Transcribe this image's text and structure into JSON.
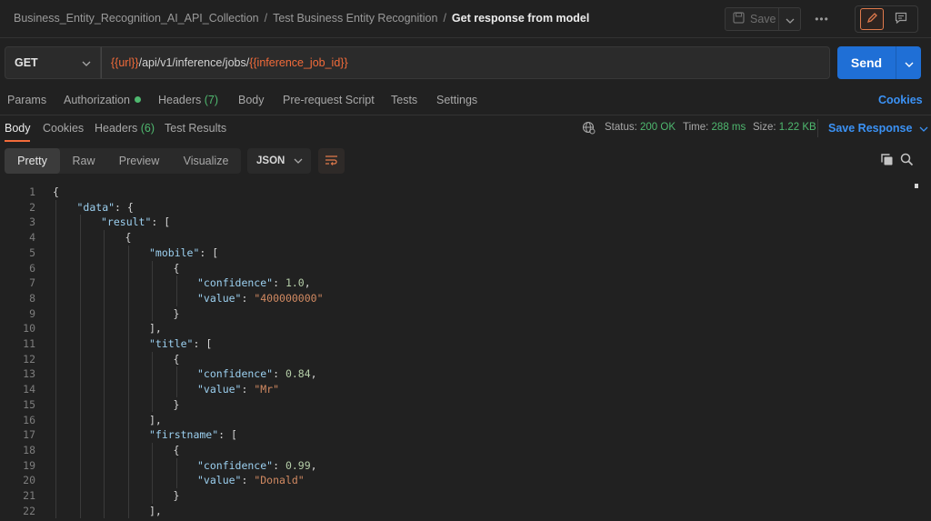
{
  "breadcrumb": {
    "items": [
      "Business_Entity_Recognition_AI_API_Collection",
      "Test Business Entity Recognition"
    ],
    "current": "Get response from model",
    "separator": "/"
  },
  "toolbar": {
    "save_label": "Save",
    "more_label": "•••"
  },
  "request": {
    "method": "GET",
    "url_var1": "{{url}}",
    "url_path": "/api/v1/inference/jobs/",
    "url_var2": "{{inference_job_id}}",
    "send_label": "Send"
  },
  "request_tabs": {
    "params": "Params",
    "authorization": "Authorization",
    "headers": "Headers",
    "headers_count": "(7)",
    "body": "Body",
    "prerequest": "Pre-request Script",
    "tests": "Tests",
    "settings": "Settings",
    "cookies": "Cookies"
  },
  "response_tabs": {
    "body": "Body",
    "cookies": "Cookies",
    "headers": "Headers",
    "headers_count": "(6)",
    "test_results": "Test Results"
  },
  "status": {
    "status_label": "Status:",
    "status_value": "200 OK",
    "time_label": "Time:",
    "time_value": "288 ms",
    "size_label": "Size:",
    "size_value": "1.22 KB",
    "save_response": "Save Response"
  },
  "view_modes": [
    "Pretty",
    "Raw",
    "Preview",
    "Visualize"
  ],
  "active_view": "Pretty",
  "format": "JSON",
  "colors": {
    "accent_orange": "#f26b3a",
    "send_blue": "#1f6fd6",
    "status_green": "#4fb86f",
    "link_blue": "#3b92f5"
  },
  "code_lines": [
    {
      "num": "1",
      "indent": 0,
      "tokens": [
        [
          "p",
          "{"
        ]
      ]
    },
    {
      "num": "2",
      "indent": 1,
      "tokens": [
        [
          "k",
          "\"data\""
        ],
        [
          "p",
          ": {"
        ]
      ]
    },
    {
      "num": "3",
      "indent": 2,
      "tokens": [
        [
          "k",
          "\"result\""
        ],
        [
          "p",
          ": ["
        ]
      ]
    },
    {
      "num": "4",
      "indent": 3,
      "tokens": [
        [
          "p",
          "{"
        ]
      ]
    },
    {
      "num": "5",
      "indent": 4,
      "tokens": [
        [
          "k",
          "\"mobile\""
        ],
        [
          "p",
          ": ["
        ]
      ]
    },
    {
      "num": "6",
      "indent": 5,
      "tokens": [
        [
          "p",
          "{"
        ]
      ]
    },
    {
      "num": "7",
      "indent": 6,
      "tokens": [
        [
          "k",
          "\"confidence\""
        ],
        [
          "p",
          ": "
        ],
        [
          "n",
          "1.0"
        ],
        [
          "p",
          ","
        ]
      ]
    },
    {
      "num": "8",
      "indent": 6,
      "tokens": [
        [
          "k",
          "\"value\""
        ],
        [
          "p",
          ": "
        ],
        [
          "s",
          "\"400000000\""
        ]
      ]
    },
    {
      "num": "9",
      "indent": 5,
      "tokens": [
        [
          "p",
          "}"
        ]
      ]
    },
    {
      "num": "10",
      "indent": 4,
      "tokens": [
        [
          "p",
          "],"
        ]
      ]
    },
    {
      "num": "11",
      "indent": 4,
      "tokens": [
        [
          "k",
          "\"title\""
        ],
        [
          "p",
          ": ["
        ]
      ]
    },
    {
      "num": "12",
      "indent": 5,
      "tokens": [
        [
          "p",
          "{"
        ]
      ]
    },
    {
      "num": "13",
      "indent": 6,
      "tokens": [
        [
          "k",
          "\"confidence\""
        ],
        [
          "p",
          ": "
        ],
        [
          "n",
          "0.84"
        ],
        [
          "p",
          ","
        ]
      ]
    },
    {
      "num": "14",
      "indent": 6,
      "tokens": [
        [
          "k",
          "\"value\""
        ],
        [
          "p",
          ": "
        ],
        [
          "s",
          "\"Mr\""
        ]
      ]
    },
    {
      "num": "15",
      "indent": 5,
      "tokens": [
        [
          "p",
          "}"
        ]
      ]
    },
    {
      "num": "16",
      "indent": 4,
      "tokens": [
        [
          "p",
          "],"
        ]
      ]
    },
    {
      "num": "17",
      "indent": 4,
      "tokens": [
        [
          "k",
          "\"firstname\""
        ],
        [
          "p",
          ": ["
        ]
      ]
    },
    {
      "num": "18",
      "indent": 5,
      "tokens": [
        [
          "p",
          "{"
        ]
      ]
    },
    {
      "num": "19",
      "indent": 6,
      "tokens": [
        [
          "k",
          "\"confidence\""
        ],
        [
          "p",
          ": "
        ],
        [
          "n",
          "0.99"
        ],
        [
          "p",
          ","
        ]
      ]
    },
    {
      "num": "20",
      "indent": 6,
      "tokens": [
        [
          "k",
          "\"value\""
        ],
        [
          "p",
          ": "
        ],
        [
          "s",
          "\"Donald\""
        ]
      ]
    },
    {
      "num": "21",
      "indent": 5,
      "tokens": [
        [
          "p",
          "}"
        ]
      ]
    },
    {
      "num": "22",
      "indent": 4,
      "tokens": [
        [
          "p",
          "],"
        ]
      ]
    }
  ]
}
